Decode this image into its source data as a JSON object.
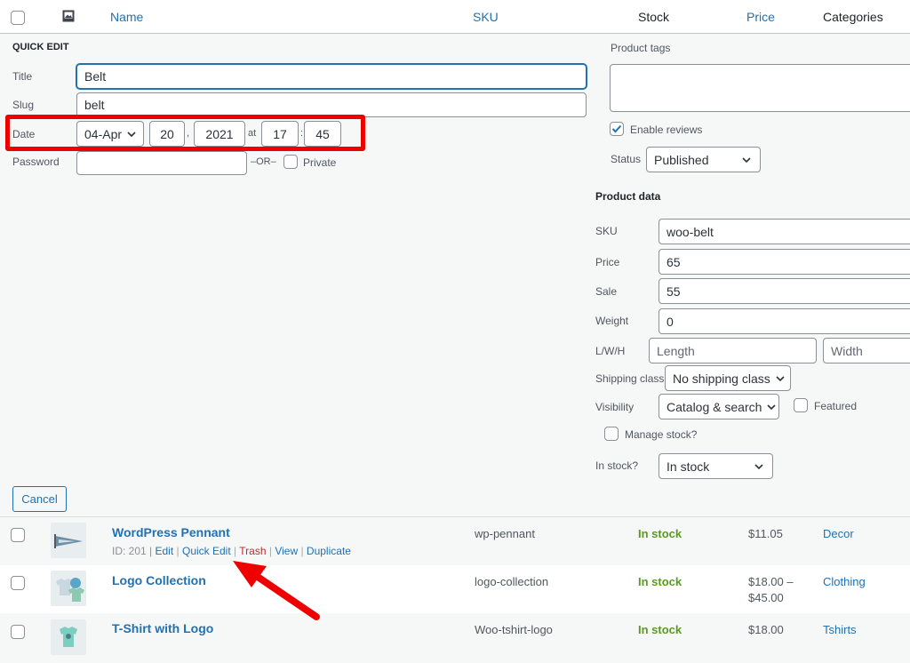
{
  "table": {
    "headers": {
      "name": "Name",
      "sku": "SKU",
      "stock": "Stock",
      "price": "Price",
      "categories": "Categories"
    }
  },
  "quick_edit": {
    "heading": "QUICK EDIT",
    "title_label": "Title",
    "title_value": "Belt",
    "slug_label": "Slug",
    "slug_value": "belt",
    "date_label": "Date",
    "date_month": "04-Apr",
    "date_day": "20",
    "date_sep": ",",
    "date_year": "2021",
    "date_at": "at",
    "date_hour": "17",
    "time_sep": ":",
    "date_minute": "45",
    "password_label": "Password",
    "password_value": "",
    "or_text": "–OR–",
    "private_label": "Private",
    "cancel_label": "Cancel",
    "product_tags_label": "Product tags",
    "enable_reviews_label": "Enable reviews",
    "status_label": "Status",
    "status_value": "Published",
    "product_data_heading": "Product data",
    "sku_label": "SKU",
    "sku_value": "woo-belt",
    "price_label": "Price",
    "price_value": "65",
    "sale_label": "Sale",
    "sale_value": "55",
    "weight_label": "Weight",
    "weight_value": "0",
    "lwh_label": "L/W/H",
    "length_placeholder": "Length",
    "width_placeholder": "Width",
    "shipping_class_label": "Shipping class",
    "shipping_class_value": "No shipping class",
    "visibility_label": "Visibility",
    "visibility_value": "Catalog & search",
    "featured_label": "Featured",
    "manage_stock_label": "Manage stock?",
    "in_stock_label": "In stock?",
    "in_stock_value": "In stock"
  },
  "rows": [
    {
      "name": "WordPress Pennant",
      "id_text": "ID: 201 |",
      "actions": {
        "edit": "Edit",
        "quick_edit": "Quick Edit",
        "trash": "Trash",
        "view": "View",
        "duplicate": "Duplicate"
      },
      "sku": "wp-pennant",
      "stock": "In stock",
      "price": "$11.05",
      "category": "Decor"
    },
    {
      "name": "Logo Collection",
      "sku": "logo-collection",
      "stock": "In stock",
      "price_line1": "$18.00 –",
      "price_line2": "$45.00",
      "category": "Clothing"
    },
    {
      "name": "T-Shirt with Logo",
      "sku": "Woo-tshirt-logo",
      "stock": "In stock",
      "price": "$18.00",
      "category": "Tshirts"
    }
  ],
  "colors": {
    "link": "#2271b1",
    "in_stock": "#5b9a22",
    "trash": "#b32d2e",
    "annotation": "#ee0000"
  }
}
